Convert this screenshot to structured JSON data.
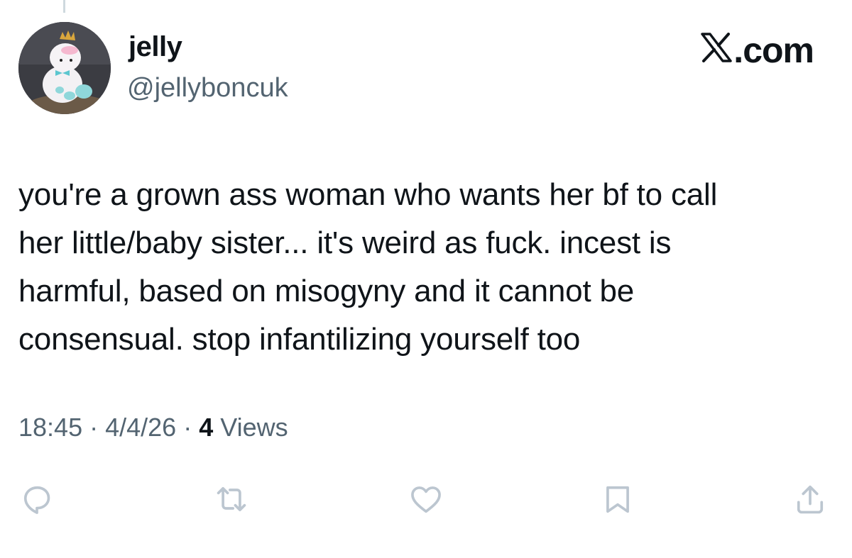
{
  "author": {
    "display_name": "jelly",
    "handle": "@jellyboncuk"
  },
  "brand": {
    "label": ".com",
    "icon": "x-logo-icon"
  },
  "tweet": {
    "text": "you're a grown ass woman who wants her bf to call\nher little/baby sister... it's weird as fuck. incest is\nharmful, based on misogyny and it cannot be\nconsensual. stop infantilizing yourself too"
  },
  "meta": {
    "time": "18:45",
    "separator": "·",
    "date": "4/4/26",
    "views_count": "4",
    "views_label": "Views"
  },
  "actions": [
    {
      "name": "reply-icon"
    },
    {
      "name": "repost-icon"
    },
    {
      "name": "like-icon"
    },
    {
      "name": "bookmark-icon"
    },
    {
      "name": "share-icon"
    }
  ],
  "colors": {
    "text": "#0f1419",
    "muted": "#536471",
    "icon": "#bcc6d0"
  }
}
